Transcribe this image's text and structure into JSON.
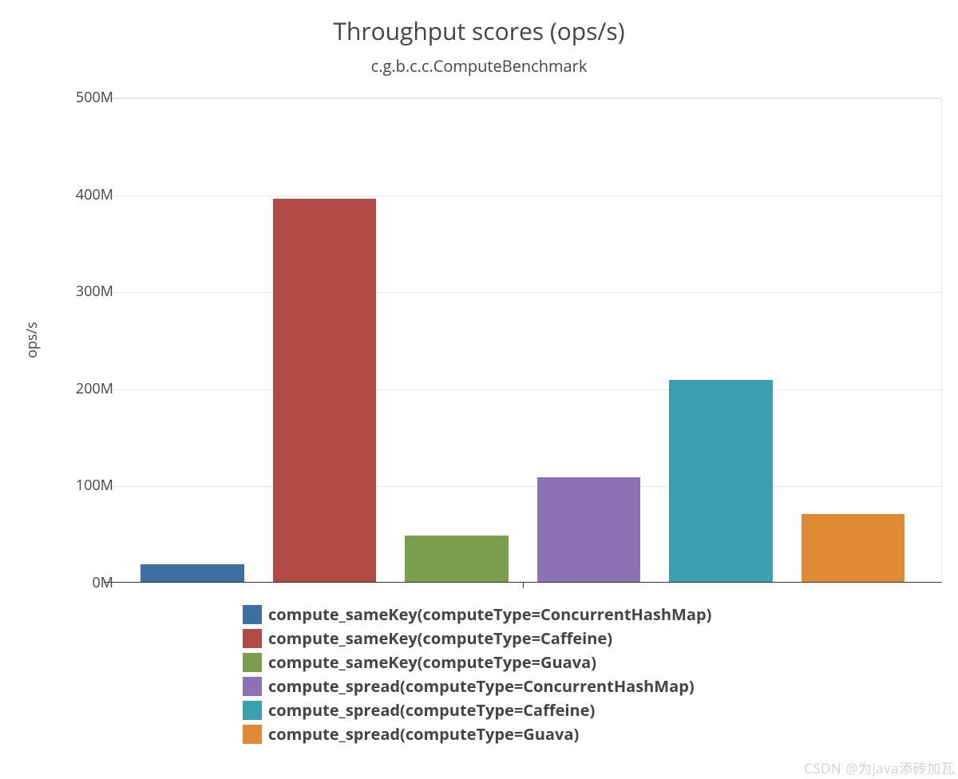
{
  "chart_data": {
    "type": "bar",
    "title": "Throughput scores (ops/s)",
    "subtitle": "c.g.b.c.c.ComputeBenchmark",
    "ylabel": "ops/s",
    "ylim": [
      0,
      500
    ],
    "y_ticks": [
      "0M",
      "100M",
      "200M",
      "300M",
      "400M",
      "500M"
    ],
    "categories": [
      "compute_sameKey(computeType=ConcurrentHashMap)",
      "compute_sameKey(computeType=Caffeine)",
      "compute_sameKey(computeType=Guava)",
      "compute_spread(computeType=ConcurrentHashMap)",
      "compute_spread(computeType=Caffeine)",
      "compute_spread(computeType=Guava)"
    ],
    "values": [
      18,
      395,
      48,
      108,
      208,
      70
    ],
    "colors": [
      "#3d6fa3",
      "#b24a46",
      "#7b9e4e",
      "#8c72b3",
      "#3a9fb1",
      "#e08a33"
    ]
  },
  "watermark": "CSDN @为java添砖加瓦"
}
